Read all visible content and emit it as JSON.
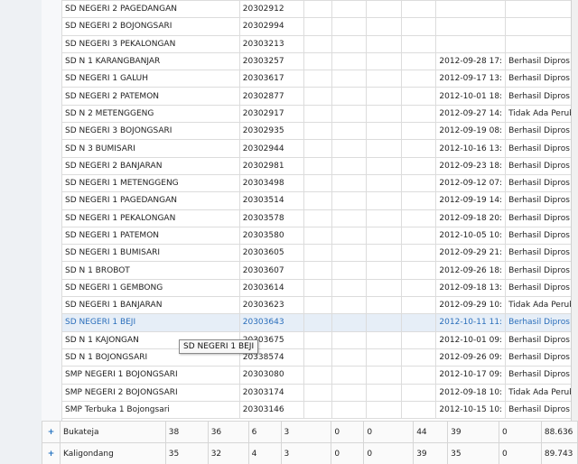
{
  "inner_rows": [
    {
      "name": "SD NEGERI 2 PAGEDANGAN",
      "code": "20302912",
      "date": "",
      "status": ""
    },
    {
      "name": "SD NEGERI 2 BOJONGSARI",
      "code": "20302994",
      "date": "",
      "status": ""
    },
    {
      "name": "SD NEGERI 3 PEKALONGAN",
      "code": "20303213",
      "date": "",
      "status": ""
    },
    {
      "name": "SD N 1 KARANGBANJAR",
      "code": "20303257",
      "date": "2012-09-28 17:",
      "status": "Berhasil Dipros"
    },
    {
      "name": "SD NEGERI 1 GALUH",
      "code": "20303617",
      "date": "2012-09-17 13:",
      "status": "Berhasil Dipros"
    },
    {
      "name": "SD NEGERI 2 PATEMON",
      "code": "20302877",
      "date": "2012-10-01 18:",
      "status": "Berhasil Dipros"
    },
    {
      "name": "SD N 2 METENGGENG",
      "code": "20302917",
      "date": "2012-09-27 14:",
      "status": "Tidak Ada Perub"
    },
    {
      "name": "SD NEGERI 3 BOJONGSARI",
      "code": "20302935",
      "date": "2012-09-19 08:",
      "status": "Berhasil Dipros"
    },
    {
      "name": "SD N 3  BUMISARI",
      "code": "20302944",
      "date": "2012-10-16 13:",
      "status": "Berhasil Dipros"
    },
    {
      "name": "SD NEGERI 2 BANJARAN",
      "code": "20302981",
      "date": "2012-09-23 18:",
      "status": "Berhasil Dipros"
    },
    {
      "name": "SD NEGERI 1 METENGGENG",
      "code": "20303498",
      "date": "2012-09-12 07:",
      "status": "Berhasil Dipros"
    },
    {
      "name": "SD NEGERI 1 PAGEDANGAN",
      "code": "20303514",
      "date": "2012-09-19 14:",
      "status": "Berhasil Dipros"
    },
    {
      "name": "SD NEGERI 1 PEKALONGAN",
      "code": "20303578",
      "date": "2012-09-18 20:",
      "status": "Berhasil Dipros"
    },
    {
      "name": "SD NEGERI 1 PATEMON",
      "code": "20303580",
      "date": "2012-10-05 10:",
      "status": "Berhasil Dipros"
    },
    {
      "name": "SD NEGERI 1 BUMISARI",
      "code": "20303605",
      "date": "2012-09-29 21:",
      "status": "Berhasil Dipros"
    },
    {
      "name": "SD N 1 BROBOT",
      "code": "20303607",
      "date": "2012-09-26 18:",
      "status": "Berhasil Dipros"
    },
    {
      "name": "SD NEGERI 1 GEMBONG",
      "code": "20303614",
      "date": "2012-09-18 13:",
      "status": "Berhasil Dipros"
    },
    {
      "name": "SD NEGERI 1 BANJARAN",
      "code": "20303623",
      "date": "2012-09-29 10:",
      "status": "Tidak Ada Perub"
    },
    {
      "name": "SD NEGERI 1 BEJI",
      "code": "20303643",
      "date": "2012-10-11 11:",
      "status": "Berhasil Dipros"
    },
    {
      "name": "SD N 1 KAJONGAN",
      "code": "20303675",
      "date": "2012-10-01 09:",
      "status": "Berhasil Dipros"
    },
    {
      "name": "SD N 1 BOJONGSARI",
      "code": "20338574",
      "date": "2012-09-26 09:",
      "status": "Berhasil Dipros"
    },
    {
      "name": "SMP NEGERI 1 BOJONGSARI",
      "code": "20303080",
      "date": "2012-10-17 09:",
      "status": "Berhasil Dipros"
    },
    {
      "name": "SMP NEGERI 2 BOJONGSARI",
      "code": "20303174",
      "date": "2012-09-18 10:",
      "status": "Tidak Ada Perub"
    },
    {
      "name": "SMP Terbuka 1 Bojongsari",
      "code": "20303146",
      "date": "2012-10-15 10:",
      "status": "Berhasil Dipros"
    }
  ],
  "tooltip": "SD NEGERI 1 BEJI",
  "outer_rows": [
    {
      "expander": "+",
      "name": "Bukateja",
      "c1": "38",
      "c2": "36",
      "c3": "6",
      "c4": "3",
      "c5": "0",
      "c6": "0",
      "c7": "44",
      "c8": "39",
      "c9": "0",
      "c10": "88.636"
    },
    {
      "expander": "+",
      "name": "Kaligondang",
      "c1": "35",
      "c2": "32",
      "c3": "4",
      "c4": "3",
      "c5": "0",
      "c6": "0",
      "c7": "39",
      "c8": "35",
      "c9": "0",
      "c10": "89.743"
    }
  ],
  "colors": {
    "selected_text": "#2a6ebb",
    "selected_bg": "#e6eef7",
    "expander": "#1e6fbf"
  }
}
